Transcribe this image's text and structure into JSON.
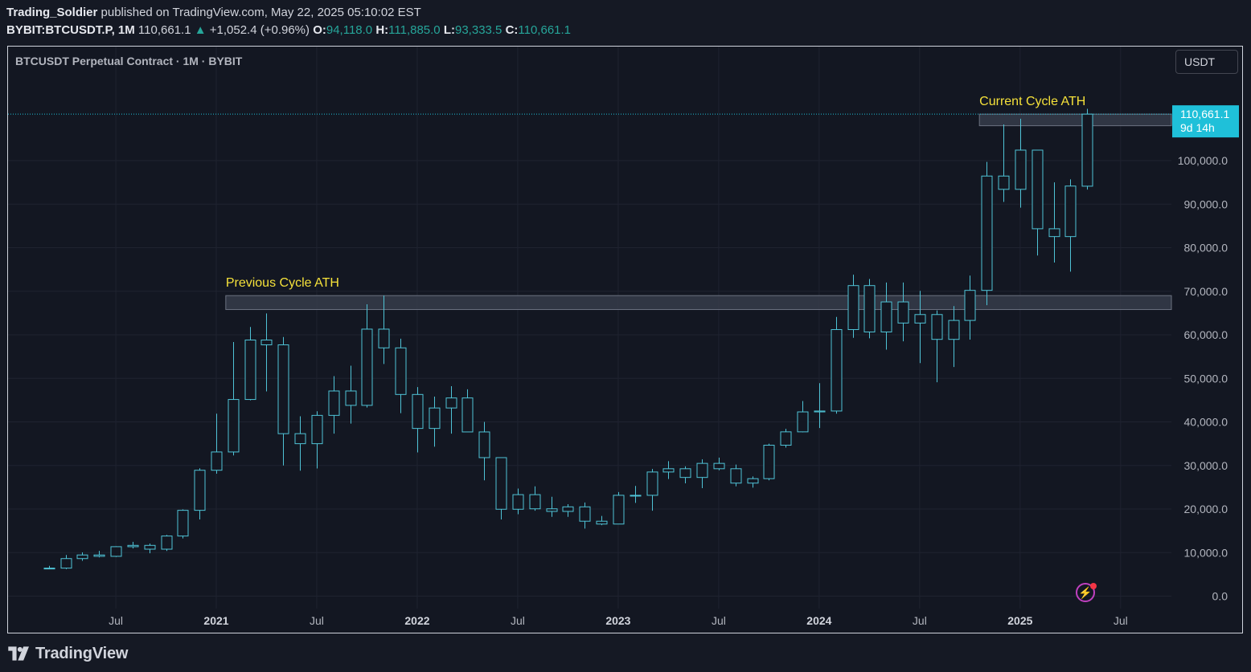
{
  "header": {
    "author": "Trading_Soldier",
    "published_text": "published on TradingView.com, May 22, 2025 05:10:02 EST",
    "symbol": "BYBIT:BTCUSDT.P, 1M",
    "last": "110,661.1",
    "change": "+1,052.4 (+0.96%)",
    "o_label": "O:",
    "o": "94,118.0",
    "h_label": "H:",
    "h": "111,885.0",
    "l_label": "L:",
    "l": "93,333.5",
    "c_label": "C:",
    "c": "110,661.1"
  },
  "chart_title": "BTCUSDT Perpetual Contract · 1M · BYBIT",
  "currency_button": "USDT",
  "price_badge": {
    "price": "110,661.1",
    "countdown": "9d 14h"
  },
  "brand": "TradingView",
  "colors": {
    "background": "#131722",
    "candle": "#4fc3d6",
    "zone_fill": "#363c4a",
    "annotation": "#f5e13a",
    "badge": "#1fc0d9"
  },
  "chart_data": {
    "type": "candlestick",
    "timeframe": "1M",
    "ylim": [
      0,
      110661.1
    ],
    "y_ticks": [
      0,
      10000,
      20000,
      30000,
      40000,
      50000,
      60000,
      70000,
      80000,
      90000,
      100000
    ],
    "y_tick_labels": [
      "0.0",
      "10,000.0",
      "20,000.0",
      "30,000.0",
      "40,000.0",
      "50,000.0",
      "60,000.0",
      "70,000.0",
      "80,000.0",
      "90,000.0",
      "100,000.0"
    ],
    "x_tick_labels": [
      "Jul",
      "2021",
      "Jul",
      "2022",
      "Jul",
      "2023",
      "Jul",
      "2024",
      "Jul",
      "2025",
      "Jul"
    ],
    "x_tick_dates": [
      "2020-07",
      "2021-01",
      "2021-07",
      "2022-01",
      "2022-07",
      "2023-01",
      "2023-07",
      "2024-01",
      "2024-07",
      "2025-01",
      "2025-07"
    ],
    "annotations": [
      {
        "text": "Previous Cycle ATH",
        "zone": [
          65800,
          69000
        ],
        "from": "2021-02"
      },
      {
        "text": "Current Cycle ATH",
        "zone": [
          108000,
          110661
        ],
        "from": "2024-11"
      }
    ],
    "candles": [
      {
        "d": "2020-03",
        "o": 6424,
        "h": 6950,
        "l": 6400,
        "c": 6430
      },
      {
        "d": "2020-04",
        "o": 6430,
        "h": 9450,
        "l": 6200,
        "c": 8620
      },
      {
        "d": "2020-05",
        "o": 8620,
        "h": 10050,
        "l": 8120,
        "c": 9450
      },
      {
        "d": "2020-06",
        "o": 9450,
        "h": 10400,
        "l": 8900,
        "c": 9140
      },
      {
        "d": "2020-07",
        "o": 9140,
        "h": 11450,
        "l": 8980,
        "c": 11350
      },
      {
        "d": "2020-08",
        "o": 11350,
        "h": 12470,
        "l": 10950,
        "c": 11650
      },
      {
        "d": "2020-09",
        "o": 11650,
        "h": 12080,
        "l": 9850,
        "c": 10780
      },
      {
        "d": "2020-10",
        "o": 10780,
        "h": 14050,
        "l": 10380,
        "c": 13800
      },
      {
        "d": "2020-11",
        "o": 13800,
        "h": 19900,
        "l": 13250,
        "c": 19700
      },
      {
        "d": "2020-12",
        "o": 19700,
        "h": 29350,
        "l": 17600,
        "c": 28900
      },
      {
        "d": "2021-01",
        "o": 28900,
        "h": 41900,
        "l": 28100,
        "c": 33100
      },
      {
        "d": "2021-02",
        "o": 33100,
        "h": 58350,
        "l": 32300,
        "c": 45150
      },
      {
        "d": "2021-03",
        "o": 45150,
        "h": 61800,
        "l": 44950,
        "c": 58800
      },
      {
        "d": "2021-04",
        "o": 58800,
        "h": 64900,
        "l": 47000,
        "c": 57700
      },
      {
        "d": "2021-05",
        "o": 57700,
        "h": 59500,
        "l": 30000,
        "c": 37300
      },
      {
        "d": "2021-06",
        "o": 37300,
        "h": 41300,
        "l": 28800,
        "c": 35000
      },
      {
        "d": "2021-07",
        "o": 35000,
        "h": 42450,
        "l": 29300,
        "c": 41500
      },
      {
        "d": "2021-08",
        "o": 41500,
        "h": 50500,
        "l": 37300,
        "c": 47100
      },
      {
        "d": "2021-09",
        "o": 47100,
        "h": 52900,
        "l": 39600,
        "c": 43800
      },
      {
        "d": "2021-10",
        "o": 43800,
        "h": 67000,
        "l": 43300,
        "c": 61300
      },
      {
        "d": "2021-11",
        "o": 61300,
        "h": 69000,
        "l": 53300,
        "c": 57000
      },
      {
        "d": "2021-12",
        "o": 57000,
        "h": 59100,
        "l": 42000,
        "c": 46300
      },
      {
        "d": "2022-01",
        "o": 46300,
        "h": 48000,
        "l": 33000,
        "c": 38500
      },
      {
        "d": "2022-02",
        "o": 38500,
        "h": 45800,
        "l": 34300,
        "c": 43200
      },
      {
        "d": "2022-03",
        "o": 43200,
        "h": 48200,
        "l": 37300,
        "c": 45500
      },
      {
        "d": "2022-04",
        "o": 45500,
        "h": 47500,
        "l": 37700,
        "c": 37700
      },
      {
        "d": "2022-05",
        "o": 37700,
        "h": 40000,
        "l": 26600,
        "c": 31800
      },
      {
        "d": "2022-06",
        "o": 31800,
        "h": 31900,
        "l": 17600,
        "c": 19950
      },
      {
        "d": "2022-07",
        "o": 19950,
        "h": 24700,
        "l": 18800,
        "c": 23300
      },
      {
        "d": "2022-08",
        "o": 23300,
        "h": 25200,
        "l": 19600,
        "c": 20050
      },
      {
        "d": "2022-09",
        "o": 20050,
        "h": 22800,
        "l": 18200,
        "c": 19450
      },
      {
        "d": "2022-10",
        "o": 19450,
        "h": 21100,
        "l": 18200,
        "c": 20500
      },
      {
        "d": "2022-11",
        "o": 20500,
        "h": 21500,
        "l": 15500,
        "c": 17200
      },
      {
        "d": "2022-12",
        "o": 17200,
        "h": 18400,
        "l": 16300,
        "c": 16550
      },
      {
        "d": "2023-01",
        "o": 16550,
        "h": 23900,
        "l": 16500,
        "c": 23150
      },
      {
        "d": "2023-02",
        "o": 23150,
        "h": 25300,
        "l": 21400,
        "c": 23150
      },
      {
        "d": "2023-03",
        "o": 23150,
        "h": 29200,
        "l": 19600,
        "c": 28500
      },
      {
        "d": "2023-04",
        "o": 28500,
        "h": 31000,
        "l": 26900,
        "c": 29250
      },
      {
        "d": "2023-05",
        "o": 29250,
        "h": 29800,
        "l": 25900,
        "c": 27250
      },
      {
        "d": "2023-06",
        "o": 27250,
        "h": 31400,
        "l": 24800,
        "c": 30480
      },
      {
        "d": "2023-07",
        "o": 30480,
        "h": 31800,
        "l": 28900,
        "c": 29250
      },
      {
        "d": "2023-08",
        "o": 29250,
        "h": 30200,
        "l": 25200,
        "c": 25950
      },
      {
        "d": "2023-09",
        "o": 25950,
        "h": 27500,
        "l": 24900,
        "c": 26970
      },
      {
        "d": "2023-10",
        "o": 26970,
        "h": 35000,
        "l": 26600,
        "c": 34650
      },
      {
        "d": "2023-11",
        "o": 34650,
        "h": 38400,
        "l": 34100,
        "c": 37720
      },
      {
        "d": "2023-12",
        "o": 37720,
        "h": 44800,
        "l": 37600,
        "c": 42300
      },
      {
        "d": "2024-01",
        "o": 42300,
        "h": 48900,
        "l": 38600,
        "c": 42500
      },
      {
        "d": "2024-02",
        "o": 42500,
        "h": 64100,
        "l": 41900,
        "c": 61200
      },
      {
        "d": "2024-03",
        "o": 61200,
        "h": 73800,
        "l": 59300,
        "c": 71300
      },
      {
        "d": "2024-04",
        "o": 71300,
        "h": 72800,
        "l": 59200,
        "c": 60650
      },
      {
        "d": "2024-05",
        "o": 60650,
        "h": 72000,
        "l": 56600,
        "c": 67550
      },
      {
        "d": "2024-06",
        "o": 67550,
        "h": 72000,
        "l": 58500,
        "c": 62700
      },
      {
        "d": "2024-07",
        "o": 62700,
        "h": 70100,
        "l": 53500,
        "c": 64650
      },
      {
        "d": "2024-08",
        "o": 64650,
        "h": 65600,
        "l": 49100,
        "c": 58950
      },
      {
        "d": "2024-09",
        "o": 58950,
        "h": 66600,
        "l": 52600,
        "c": 63300
      },
      {
        "d": "2024-10",
        "o": 63300,
        "h": 73600,
        "l": 58900,
        "c": 70200
      },
      {
        "d": "2024-11",
        "o": 70200,
        "h": 99700,
        "l": 66800,
        "c": 96450
      },
      {
        "d": "2024-12",
        "o": 96450,
        "h": 108300,
        "l": 90500,
        "c": 93400
      },
      {
        "d": "2025-01",
        "o": 93400,
        "h": 109600,
        "l": 89200,
        "c": 102400
      },
      {
        "d": "2025-02",
        "o": 102400,
        "h": 102500,
        "l": 78200,
        "c": 84350
      },
      {
        "d": "2025-03",
        "o": 84350,
        "h": 95000,
        "l": 76600,
        "c": 82550
      },
      {
        "d": "2025-04",
        "o": 82550,
        "h": 95700,
        "l": 74500,
        "c": 94150
      },
      {
        "d": "2025-05",
        "o": 94118,
        "h": 111885,
        "l": 93333.5,
        "c": 110661.1
      }
    ]
  }
}
